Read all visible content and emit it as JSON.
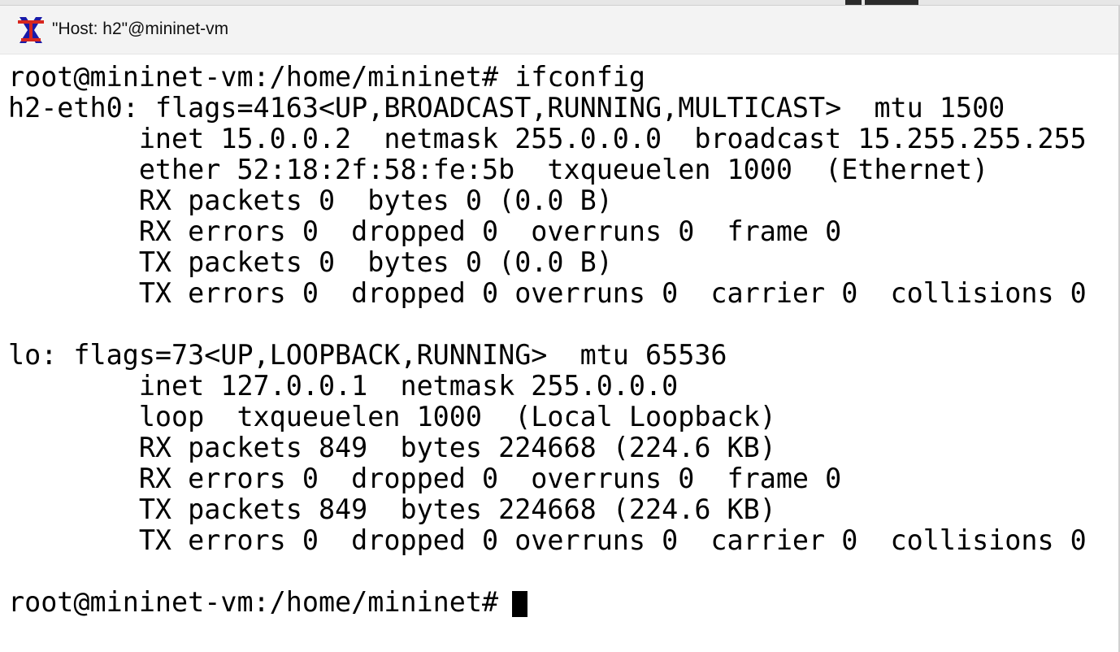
{
  "window": {
    "title": "\"Host: h2\"@mininet-vm",
    "icon": "x-window-icon"
  },
  "colors": {
    "terminal_bg": "#ffffff",
    "terminal_fg": "#000000",
    "titlebar_bg": "#f3f3f3",
    "icon_red": "#d7261e",
    "icon_blue": "#1a1aa8"
  },
  "terminal": {
    "lines": [
      "root@mininet-vm:/home/mininet# ifconfig",
      "h2-eth0: flags=4163<UP,BROADCAST,RUNNING,MULTICAST>  mtu 1500",
      "        inet 15.0.0.2  netmask 255.0.0.0  broadcast 15.255.255.255",
      "        ether 52:18:2f:58:fe:5b  txqueuelen 1000  (Ethernet)",
      "        RX packets 0  bytes 0 (0.0 B)",
      "        RX errors 0  dropped 0  overruns 0  frame 0",
      "        TX packets 0  bytes 0 (0.0 B)",
      "        TX errors 0  dropped 0 overruns 0  carrier 0  collisions 0",
      "",
      "lo: flags=73<UP,LOOPBACK,RUNNING>  mtu 65536",
      "        inet 127.0.0.1  netmask 255.0.0.0",
      "        loop  txqueuelen 1000  (Local Loopback)",
      "        RX packets 849  bytes 224668 (224.6 KB)",
      "        RX errors 0  dropped 0  overruns 0  frame 0",
      "        TX packets 849  bytes 224668 (224.6 KB)",
      "        TX errors 0  dropped 0 overruns 0  carrier 0  collisions 0",
      "",
      "root@mininet-vm:/home/mininet# "
    ]
  }
}
